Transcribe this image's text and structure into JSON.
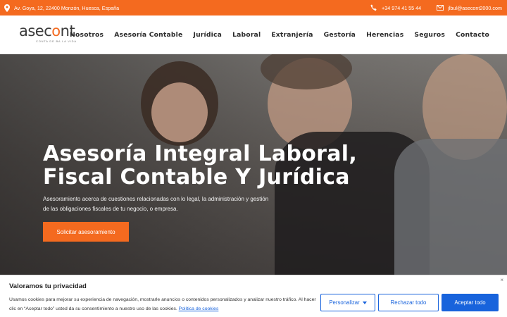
{
  "topbar": {
    "address": "Av. Goya, 12, 22400 Monzón, Huesca, España",
    "phone": "+34 974 41 55 44",
    "email": "jlbul@asecont2000.com"
  },
  "logo": {
    "text_a": "asec",
    "text_o": "o",
    "text_b": "nt",
    "tagline": "CONTA DE BA LA VIDA"
  },
  "nav": [
    "Nosotros",
    "Asesoría Contable",
    "Jurídica",
    "Laboral",
    "Extranjería",
    "Gestoría",
    "Herencias",
    "Seguros",
    "Contacto"
  ],
  "hero": {
    "title_line1": "Asesoría Integral Laboral,",
    "title_line2": "Fiscal Contable Y Jurídica",
    "subtitle": "Asesoramiento acerca de cuestiones relacionadas con lo legal, la administración y gestión de las obligaciones fiscales de tu negocio, o empresa.",
    "cta": "Solicitar asesoramiento"
  },
  "cookie": {
    "title": "Valoramos tu privacidad",
    "text": "Usamos cookies para mejorar su experiencia de navegación, mostrarle anuncios o contenidos personalizados y analizar nuestro tráfico. Al hacer clic en “Aceptar todo” usted da su consentimiento a nuestro uso de las cookies.",
    "policy_link": "Política de cookies",
    "close": "×",
    "customize": "Personalizar",
    "reject": "Rechazar todo",
    "accept": "Aceptar todo"
  },
  "colors": {
    "brand_orange": "#f46a1f",
    "cookie_blue": "#1863dc"
  }
}
